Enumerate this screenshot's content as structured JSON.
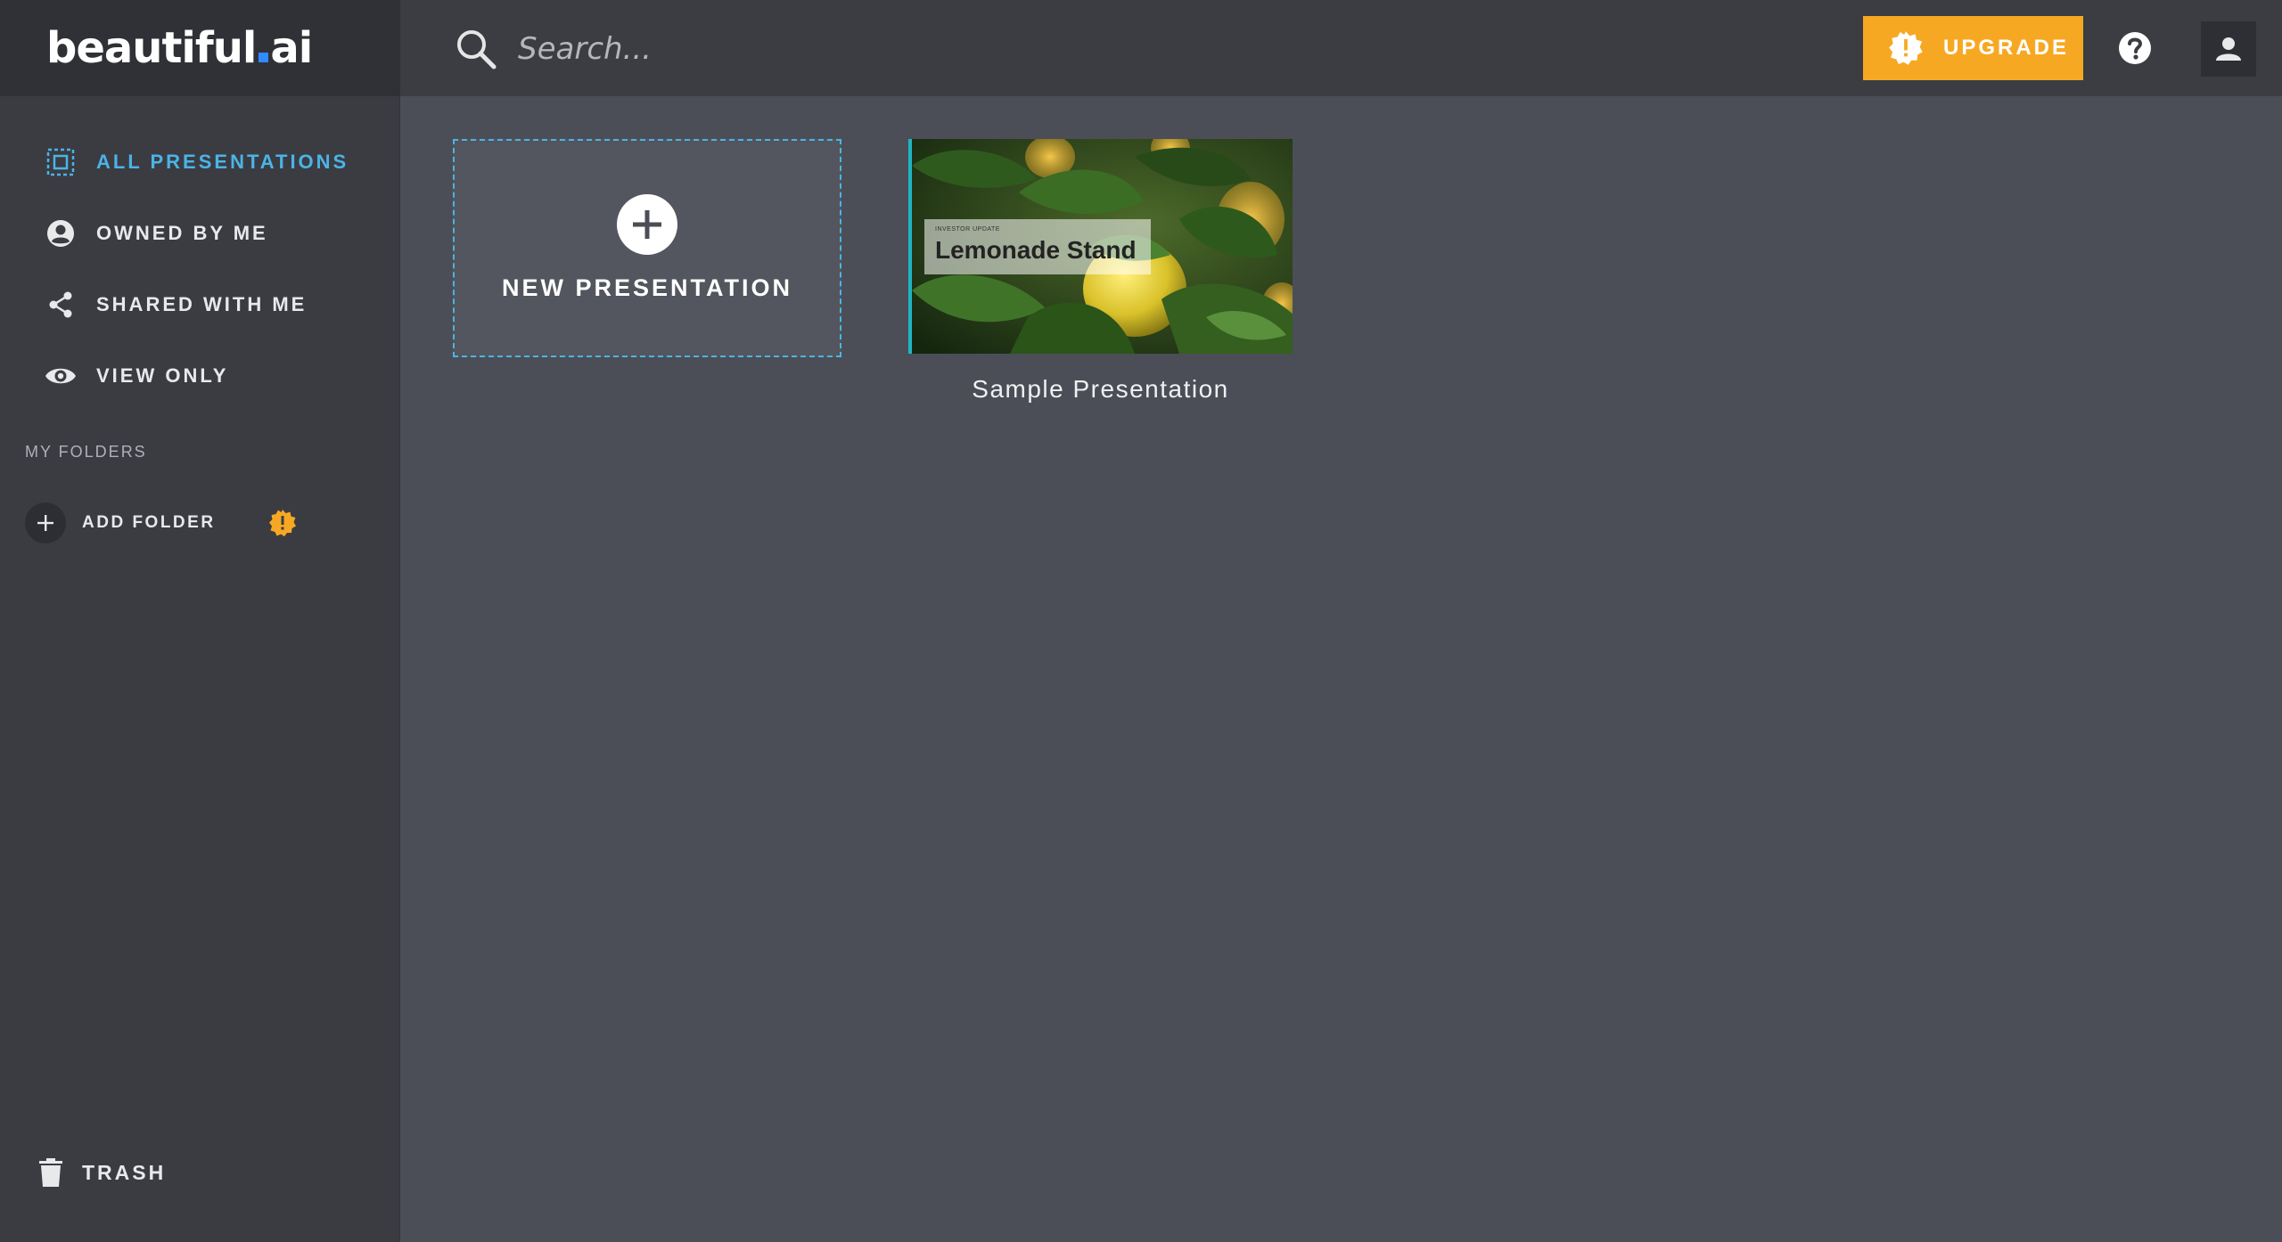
{
  "brand": {
    "name_left": "beautiful",
    "name_right": "ai"
  },
  "search": {
    "placeholder": "Search..."
  },
  "toolbar": {
    "upgrade_label": "UPGRADE"
  },
  "sidebar": {
    "items": [
      {
        "label": "ALL PRESENTATIONS",
        "icon": "all-presentations-icon",
        "active": true
      },
      {
        "label": "OWNED BY ME",
        "icon": "user-circle-icon",
        "active": false
      },
      {
        "label": "SHARED WITH ME",
        "icon": "share-icon",
        "active": false
      },
      {
        "label": "VIEW ONLY",
        "icon": "eye-icon",
        "active": false
      }
    ],
    "folders_title": "MY FOLDERS",
    "add_folder_label": "ADD FOLDER",
    "trash_label": "TRASH"
  },
  "content": {
    "new_presentation_label": "NEW PRESENTATION",
    "presentations": [
      {
        "name": "Sample Presentation",
        "thumbnail": {
          "kicker": "INVESTOR UPDATE",
          "title": "Lemonade Stand"
        }
      }
    ]
  },
  "colors": {
    "accent": "#4cb3e6",
    "upgrade": "#f7a823",
    "sidebar_bg": "#3a3c42",
    "content_bg": "#4b4e56",
    "brand_dot": "#2f8bff"
  }
}
